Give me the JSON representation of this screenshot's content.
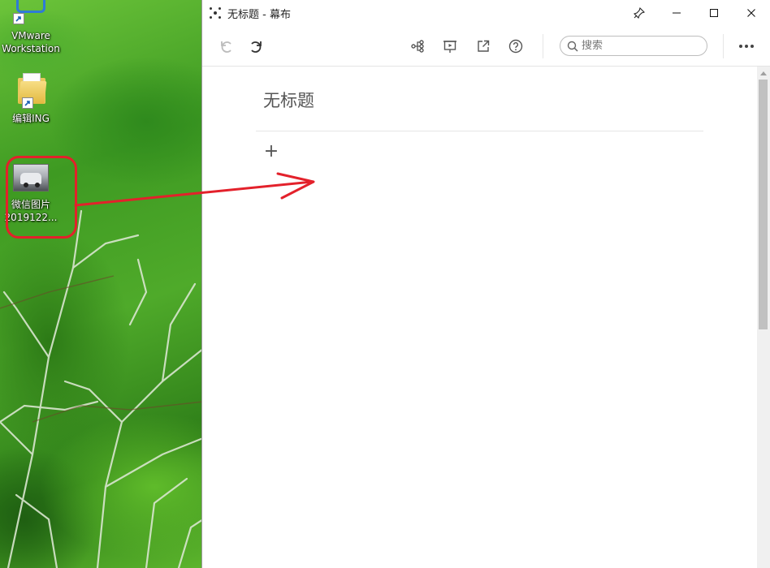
{
  "desktop": {
    "icons": [
      {
        "label_line1": "VMware",
        "label_line2": "Workstation",
        "icon": "vmware-icon"
      },
      {
        "label_line1": "编辑ING",
        "label_line2": "",
        "icon": "folder-icon"
      },
      {
        "label_line1": "微信图片",
        "label_line2": "2019122...",
        "icon": "image-file-icon"
      }
    ],
    "annotation_color": "#e3212b"
  },
  "window": {
    "title": "无标题 - 幕布",
    "controls": [
      "pin-icon",
      "minimize-icon",
      "maximize-icon",
      "close-icon"
    ]
  },
  "toolbar": {
    "buttons": [
      "undo-icon",
      "redo-icon",
      "mindmap-icon",
      "presentation-icon",
      "export-icon",
      "help-icon",
      "more-icon"
    ],
    "search": {
      "placeholder": "搜索",
      "value": ""
    }
  },
  "document": {
    "title": "无标题",
    "add_symbol": "+"
  }
}
